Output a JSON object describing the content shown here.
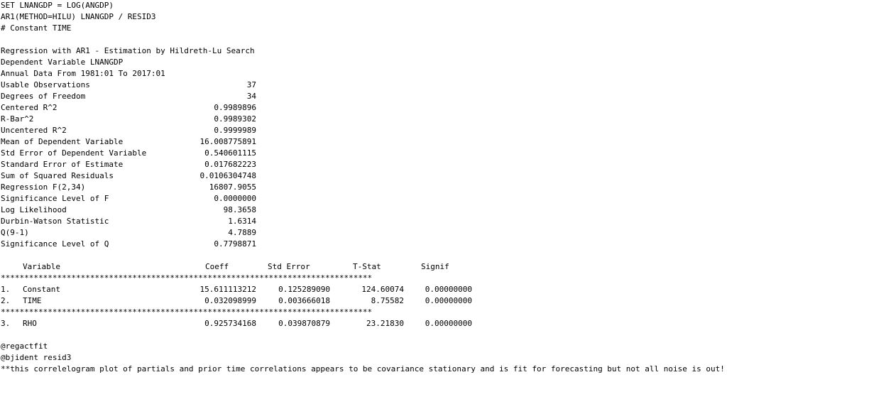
{
  "commands": {
    "set": "SET LNANGDP = LOG(ANGDP)",
    "ar1": "AR1(METHOD=HILU) LNANGDP / RESID3",
    "regressors": "# Constant TIME"
  },
  "header": {
    "title": "Regression with AR1 - Estimation by Hildreth-Lu Search",
    "dependent": "Dependent Variable LNANGDP",
    "range": "Annual Data From 1981:01 To 2017:01"
  },
  "stats": [
    {
      "label": "Usable Observations",
      "value": "37"
    },
    {
      "label": "Degrees of Freedom",
      "value": "34"
    },
    {
      "label": "Centered R^2",
      "value": "0.9989896"
    },
    {
      "label": "R-Bar^2",
      "value": "0.9989302"
    },
    {
      "label": "Uncentered R^2",
      "value": "0.9999989"
    },
    {
      "label": "Mean of Dependent Variable",
      "value": "16.008775891"
    },
    {
      "label": "Std Error of Dependent Variable",
      "value": "0.540601115"
    },
    {
      "label": "Standard Error of Estimate",
      "value": "0.017682223"
    },
    {
      "label": "Sum of Squared Residuals",
      "value": "0.0106304748"
    },
    {
      "label": "Regression F(2,34)",
      "value": "16807.9055"
    },
    {
      "label": "Significance Level of F",
      "value": "0.0000000"
    },
    {
      "label": "Log Likelihood",
      "value": "98.3658"
    },
    {
      "label": "Durbin-Watson Statistic",
      "value": "1.6314"
    },
    {
      "label": "Q(9-1)",
      "value": "4.7889"
    },
    {
      "label": "Significance Level of Q",
      "value": "0.7798871"
    }
  ],
  "table": {
    "headers": [
      "Variable",
      "Coeff",
      "Std Error",
      "T-Stat",
      "Signif"
    ],
    "separator": "*******************************************************************************",
    "rows": [
      {
        "num": "1.",
        "name": "Constant",
        "coeff": "15.611113212",
        "stderr": "0.125289090",
        "tstat": "124.60074",
        "signif": "0.00000000"
      },
      {
        "num": "2.",
        "name": "TIME",
        "coeff": "0.032098999",
        "stderr": "0.003666018",
        "tstat": "8.75582",
        "signif": "0.00000000"
      },
      {
        "num": "3.",
        "name": "RHO",
        "coeff": "0.925734168",
        "stderr": "0.039870879",
        "tstat": "23.21830",
        "signif": "0.00000000"
      }
    ]
  },
  "footer": {
    "cmd1": "@regactfit",
    "cmd2": "@bjident resid3",
    "comment": "**this correlelogram plot of partials and prior time correlations appears to be covariance stationary and is fit for forecasting but not all noise is out!"
  }
}
